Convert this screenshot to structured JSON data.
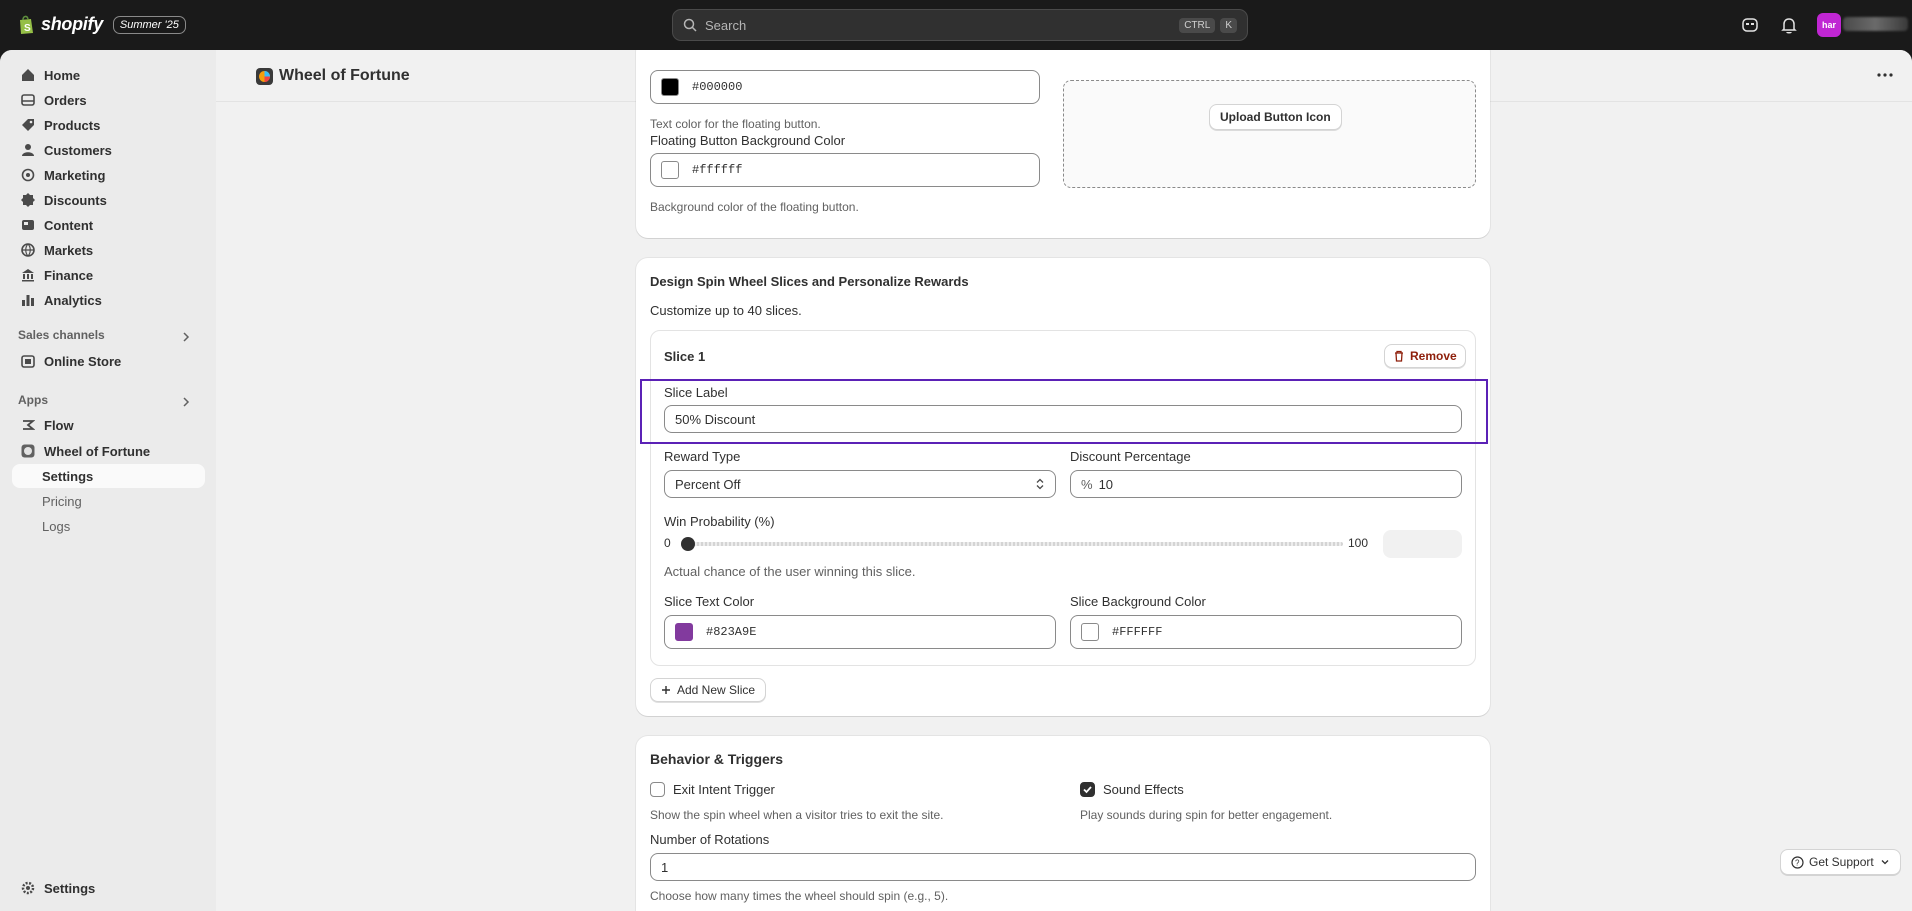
{
  "topbar": {
    "logo_text": "shopify",
    "edition": "Summer '25",
    "search_placeholder": "Search",
    "shortcut_keys": [
      "CTRL",
      "K"
    ],
    "avatar_initials": "har"
  },
  "sidebar": {
    "main_items": [
      {
        "label": "Home",
        "icon": "home-icon"
      },
      {
        "label": "Orders",
        "icon": "orders-icon"
      },
      {
        "label": "Products",
        "icon": "tag-icon"
      },
      {
        "label": "Customers",
        "icon": "person-icon"
      },
      {
        "label": "Marketing",
        "icon": "target-icon"
      },
      {
        "label": "Discounts",
        "icon": "discount-icon"
      },
      {
        "label": "Content",
        "icon": "content-icon"
      },
      {
        "label": "Markets",
        "icon": "globe-icon"
      },
      {
        "label": "Finance",
        "icon": "bank-icon"
      },
      {
        "label": "Analytics",
        "icon": "bar-chart-icon"
      }
    ],
    "sales_channels_label": "Sales channels",
    "online_store_label": "Online Store",
    "apps_label": "Apps",
    "flow_label": "Flow",
    "wheel_app_label": "Wheel of Fortune",
    "app_sub_items": [
      "Settings",
      "Pricing",
      "Logs"
    ],
    "settings_label": "Settings"
  },
  "page": {
    "title": "Wheel of Fortune"
  },
  "floating_button_card": {
    "text_color_value": "#000000",
    "text_color_help": "Text color for the floating button.",
    "bg_color_label": "Floating Button Background Color",
    "bg_color_value": "#ffffff",
    "bg_color_help": "Background color of the floating button.",
    "upload_icon_button": "Upload Button Icon"
  },
  "slices_card": {
    "title": "Design Spin Wheel Slices and Personalize Rewards",
    "subtitle": "Customize up to 40 slices.",
    "slice": {
      "title": "Slice 1",
      "remove_label": "Remove",
      "label_label": "Slice Label",
      "label_value": "50% Discount",
      "reward_type_label": "Reward Type",
      "reward_type_value": "Percent Off",
      "discount_label": "Discount Percentage",
      "discount_prefix": "%",
      "discount_value": "10",
      "win_prob_label": "Win Probability (%)",
      "slider_min": "0",
      "slider_max": "100",
      "slider_value": 0,
      "win_prob_help": "Actual chance of the user winning this slice.",
      "text_color_label": "Slice Text Color",
      "text_color_value": "#823A9E",
      "bg_color_label": "Slice Background Color",
      "bg_color_value": "#FFFFFF"
    },
    "add_slice_label": "Add New Slice"
  },
  "behavior_card": {
    "title": "Behavior & Triggers",
    "exit_intent_label": "Exit Intent Trigger",
    "exit_intent_checked": false,
    "exit_intent_help": "Show the spin wheel when a visitor tries to exit the site.",
    "sound_label": "Sound Effects",
    "sound_checked": true,
    "sound_help": "Play sounds during spin for better engagement.",
    "rotations_label": "Number of Rotations",
    "rotations_value": "1",
    "rotations_help": "Choose how many times the wheel should spin (e.g., 5)."
  },
  "support": {
    "label": "Get Support"
  },
  "colors": {
    "highlight_border": "#5b21b6",
    "slice_text_color": "#823A9E",
    "avatar": "#c026d3"
  }
}
